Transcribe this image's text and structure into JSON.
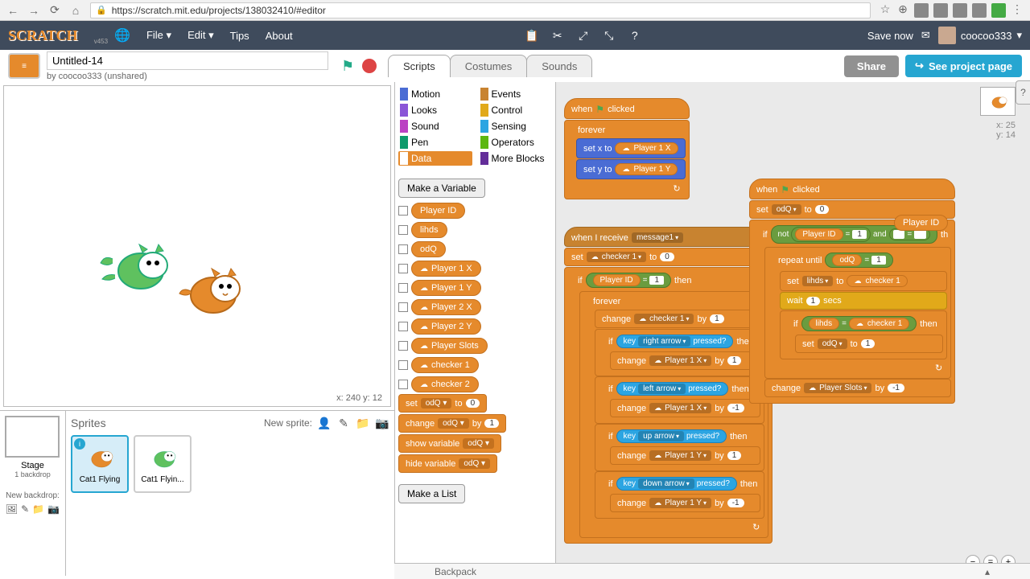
{
  "browser": {
    "url": "https://scratch.mit.edu/projects/138032410/#editor"
  },
  "header": {
    "version": "v453",
    "file": "File ▾",
    "edit": "Edit ▾",
    "tips": "Tips",
    "about": "About",
    "save_now": "Save now",
    "username": "coocoo333"
  },
  "project": {
    "title": "Untitled-14",
    "author": "by coocoo333 (unshared)",
    "share": "Share",
    "see_page": "See project page"
  },
  "tabs": {
    "scripts": "Scripts",
    "costumes": "Costumes",
    "sounds": "Sounds"
  },
  "categories": {
    "motion": "Motion",
    "looks": "Looks",
    "sound": "Sound",
    "pen": "Pen",
    "data": "Data",
    "events": "Events",
    "control": "Control",
    "sensing": "Sensing",
    "operators": "Operators",
    "more": "More Blocks"
  },
  "palette": {
    "make_variable": "Make a Variable",
    "make_list": "Make a List",
    "vars": [
      "Player ID",
      "lihds",
      "odQ",
      "Player 1 X",
      "Player 1 Y",
      "Player 2 X",
      "Player 2 Y",
      "Player Slots",
      "checker 1",
      "checker 2"
    ],
    "set_to": "set",
    "to": "to",
    "change": "change",
    "by": "by",
    "show_var": "show variable",
    "hide_var": "hide variable",
    "odq": "odQ",
    "zero": "0",
    "one": "1"
  },
  "stage": {
    "coords": "x: 240  y: 12",
    "label": "Stage",
    "backdrop": "1 backdrop",
    "new_backdrop": "New backdrop:"
  },
  "sprites": {
    "title": "Sprites",
    "new_sprite": "New sprite:",
    "items": [
      "Cat1 Flying",
      "Cat1 Flyin..."
    ]
  },
  "corner": {
    "x": "x: 25",
    "y": "y: 14"
  },
  "scripts": {
    "when": "when",
    "clicked": "clicked",
    "forever": "forever",
    "set_x_to": "set x to",
    "set_y_to": "set y to",
    "p1x": "Player 1 X",
    "p1y": "Player 1 Y",
    "when_receive": "when I receive",
    "message1": "message1",
    "set": "set",
    "to": "to",
    "checker1": "checker 1",
    "zero": "0",
    "if": "if",
    "then": "then",
    "player_id": "Player ID",
    "eq1": "1",
    "change": "change",
    "by": "by",
    "one": "1",
    "neg1": "-1",
    "key": "key",
    "pressed": "pressed?",
    "right_arrow": "right arrow",
    "left_arrow": "left arrow",
    "up_arrow": "up arrow",
    "down_arrow": "down arrow",
    "odq": "odQ",
    "not": "not",
    "and": "and",
    "repeat_until": "repeat until",
    "lihds": "lihds",
    "wait": "wait",
    "secs": "secs",
    "player_slots": "Player Slots",
    "th": "th"
  },
  "backpack": "Backpack"
}
